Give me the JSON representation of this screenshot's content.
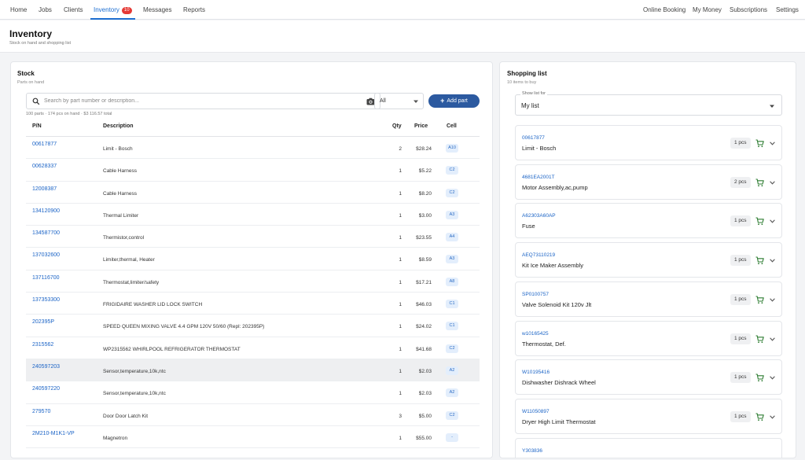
{
  "nav": {
    "left": [
      {
        "label": "Home"
      },
      {
        "label": "Jobs"
      },
      {
        "label": "Clients"
      },
      {
        "label": "Inventory",
        "badge": "10",
        "active": true
      },
      {
        "label": "Messages"
      },
      {
        "label": "Reports"
      }
    ],
    "right": [
      {
        "label": "Online Booking"
      },
      {
        "label": "My Money"
      },
      {
        "label": "Subscriptions"
      },
      {
        "label": "Settings"
      }
    ]
  },
  "page": {
    "title": "Inventory",
    "subtitle": "Stock on hand and shopping list"
  },
  "stock": {
    "title": "Stock",
    "subtitle": "Parts on hand",
    "search_placeholder": "Search by part number or description...",
    "filter_value": "All",
    "add_label": "Add part",
    "summary": "100 parts · 174 pcs on hand · $3 116.57 total",
    "columns": {
      "pn": "P/N",
      "desc": "Description",
      "qty": "Qty",
      "price": "Price",
      "cell": "Cell"
    },
    "rows": [
      {
        "pn": "00617877",
        "desc": "Limit - Bosch",
        "qty": "2",
        "price": "$28.24",
        "cell": "A10"
      },
      {
        "pn": "00628337",
        "desc": "Cable Harness",
        "qty": "1",
        "price": "$5.22",
        "cell": "C2"
      },
      {
        "pn": "12008387",
        "desc": "Cable Harness",
        "qty": "1",
        "price": "$8.20",
        "cell": "C2"
      },
      {
        "pn": "134120900",
        "desc": "Thermal Limiter",
        "qty": "1",
        "price": "$3.00",
        "cell": "A3"
      },
      {
        "pn": "134587700",
        "desc": "Thermistor,control",
        "qty": "1",
        "price": "$23.55",
        "cell": "A4"
      },
      {
        "pn": "137032600",
        "desc": "Limiter,thermal, Heater",
        "qty": "1",
        "price": "$8.59",
        "cell": "A3"
      },
      {
        "pn": "137116700",
        "desc": "Thermostat,limiter/safety",
        "qty": "1",
        "price": "$17.21",
        "cell": "A8"
      },
      {
        "pn": "137353300",
        "desc": "FRIGIDAIRE WASHER LID LOCK SWITCH",
        "qty": "1",
        "price": "$46.03",
        "cell": "C1"
      },
      {
        "pn": "202395P",
        "desc": "SPEED QUEEN MIXING VALVE 4.4 GPM 120V 50/60 (Repl: 202395P)",
        "qty": "1",
        "price": "$24.02",
        "cell": "C1"
      },
      {
        "pn": "2315562",
        "desc": "WP2315562 WHIRLPOOL REFRIGERATOR THERMOSTAT",
        "qty": "1",
        "price": "$41.68",
        "cell": "C2"
      },
      {
        "pn": "240597203",
        "desc": "Sensor,temperature,10k,ntc",
        "qty": "1",
        "price": "$2.03",
        "cell": "A2",
        "highlight": true
      },
      {
        "pn": "240597220",
        "desc": "Sensor,temperature,10k,ntc",
        "qty": "1",
        "price": "$2.03",
        "cell": "A2"
      },
      {
        "pn": "279570",
        "desc": "Door Door Latch Kit",
        "qty": "3",
        "price": "$5.00",
        "cell": "C2"
      },
      {
        "pn": "2M210-M1K1-VP",
        "desc": "Magnetron",
        "qty": "1",
        "price": "$55.00",
        "cell": "-"
      }
    ]
  },
  "shopping": {
    "title": "Shopping list",
    "subtitle": "10 items to buy",
    "show_for_label": "Show list for",
    "show_for_value": "My list",
    "items": [
      {
        "pn": "00617877",
        "desc": "Limit - Bosch",
        "qty": "1 pcs"
      },
      {
        "pn": "4681EA2001T",
        "desc": "Motor Assembly,ac,pump",
        "qty": "2 pcs"
      },
      {
        "pn": "A62303A60AP",
        "desc": "Fuse",
        "qty": "1 pcs"
      },
      {
        "pn": "AEQ73110219",
        "desc": "Kit Ice Maker Assembly",
        "qty": "1 pcs"
      },
      {
        "pn": "SP0100757",
        "desc": "Valve Solenoid Kit 120v Jlt",
        "qty": "1 pcs"
      },
      {
        "pn": "w10165425",
        "desc": "Thermostat, Def.",
        "qty": "1 pcs"
      },
      {
        "pn": "W10195416",
        "desc": "Dishwasher Dishrack Wheel",
        "qty": "1 pcs"
      },
      {
        "pn": "W11050897",
        "desc": "Dryer High Limit Thermostat",
        "qty": "1 pcs"
      },
      {
        "pn": "Y303836",
        "desc": "",
        "qty": ""
      }
    ]
  },
  "icons": {
    "search": "search-icon",
    "camera": "camera-icon",
    "dropdown": "chevron-down-icon",
    "plus": "plus-icon",
    "cart": "cart-icon",
    "expand": "chevron-down-icon"
  },
  "colors": {
    "accent": "#1f6fd1",
    "primary_button": "#2c5aa0",
    "badge": "#e53935",
    "link": "#1a63c6",
    "cart": "#2e7d32"
  }
}
